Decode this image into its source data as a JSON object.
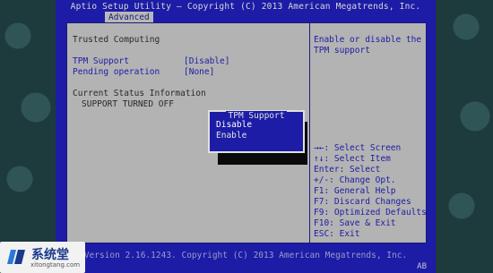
{
  "header": {
    "title": "Aptio Setup Utility – Copyright (C) 2013 American Megatrends, Inc.",
    "tab": "Advanced"
  },
  "main": {
    "section_title": "Trusted Computing",
    "settings": [
      {
        "label": "TPM Support",
        "value": "[Disable]"
      },
      {
        "label": "Pending operation",
        "value": "[None]"
      }
    ],
    "status_title": "Current Status Information",
    "status_value": "SUPPORT TURNED OFF"
  },
  "popup": {
    "title": "TPM Support",
    "options": [
      "Disable",
      "Enable"
    ],
    "selected": "Disable"
  },
  "help": {
    "description_line1": "Enable or disable the",
    "description_line2": "TPM support",
    "keys": [
      "→←: Select Screen",
      "↑↓: Select Item",
      "Enter: Select",
      "+/-: Change Opt.",
      "F1: General Help",
      "F7: Discard Changes",
      "F9: Optimized Defaults",
      "F10: Save & Exit",
      "ESC: Exit"
    ]
  },
  "footer": {
    "version": "Version 2.16.1243. Copyright (C) 2013 American Megatrends, Inc.",
    "badge": "AB"
  },
  "watermark": {
    "name": "系统堂",
    "url": "xitongtang.com"
  },
  "colors": {
    "bios_blue": "#1c1ca6",
    "panel_gray": "#b3b3b3",
    "popup_border": "#e0e0e0"
  }
}
